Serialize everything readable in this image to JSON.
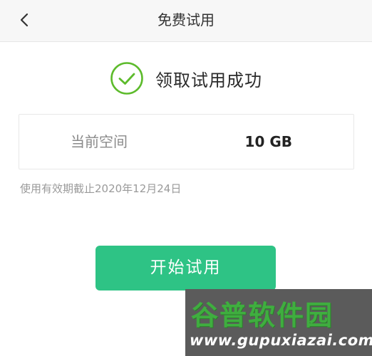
{
  "header": {
    "title": "免费试用",
    "back_icon": "chevron-left-icon"
  },
  "success": {
    "icon": "check-circle-icon",
    "message": "领取试用成功",
    "accent": "#5dbb2c"
  },
  "space": {
    "label": "当前空间",
    "value": "10 GB"
  },
  "validity_text": "使用有效期截止2020年12月24日",
  "start_button": {
    "label": "开始试用",
    "color": "#2ec385"
  },
  "watermark": {
    "title": "谷普软件园",
    "url": "www.gupuxiazai.com"
  }
}
